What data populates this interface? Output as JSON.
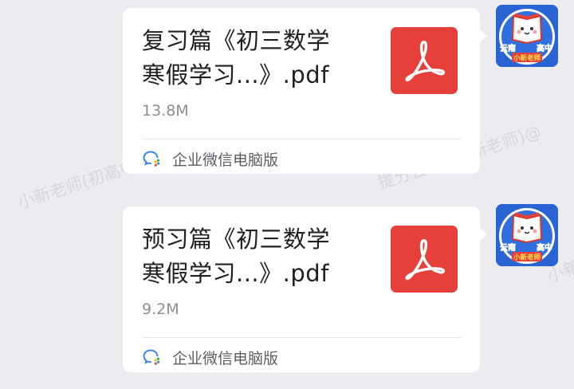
{
  "watermark": {
    "text_1": "小新老师(初高中",
    "text_2": "提分咨询)(小新老师)@",
    "text_3": "小新老师(初",
    "text_4": "小新"
  },
  "messages": [
    {
      "file_title_line1": "复习篇《初三数学",
      "file_title_line2": "寒假学习...》.pdf",
      "file_size": "13.8M",
      "file_icon": "pdf-icon",
      "source_icon": "wecom-icon",
      "source_label": "企业微信电脑版"
    },
    {
      "file_title_line1": "预习篇《初三数学",
      "file_title_line2": "寒假学习...》.pdf",
      "file_size": "9.2M",
      "file_icon": "pdf-icon",
      "source_icon": "wecom-icon",
      "source_label": "企业微信电脑版"
    }
  ],
  "avatar": {
    "logo_text_left": "云南",
    "logo_text_right": "高中",
    "logo_text_bottom": "小新老师",
    "icon": "cartoon-book-avatar"
  },
  "colors": {
    "background": "#ececf0",
    "bubble": "#ffffff",
    "pdf_red": "#e5403a",
    "avatar_blue": "#2a63d4"
  }
}
